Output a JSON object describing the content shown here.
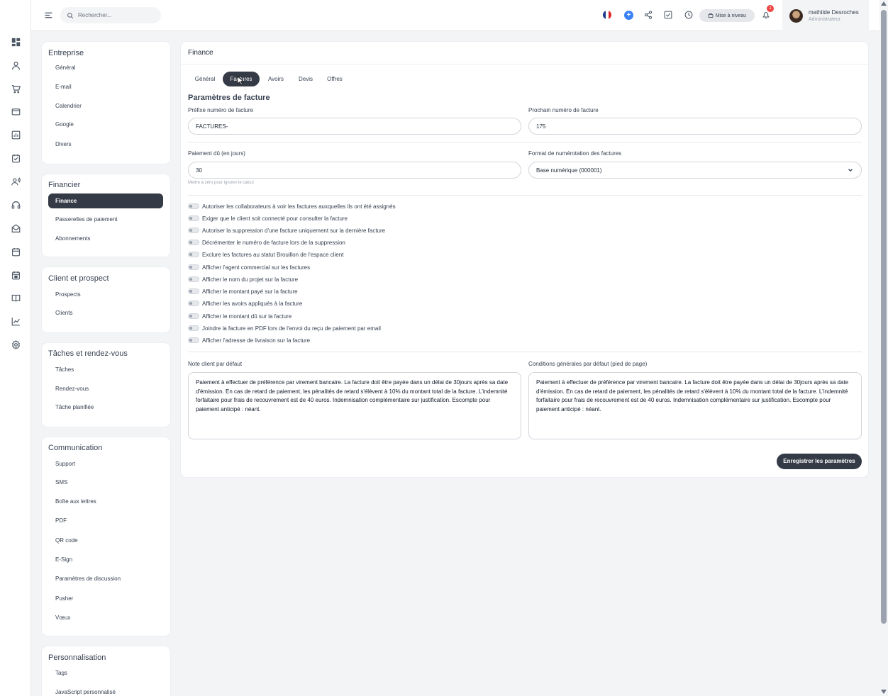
{
  "search": {
    "placeholder": "Rechercher..."
  },
  "topbar": {
    "upgrade_label": "Mise à niveau",
    "notifications_count": "1",
    "user_name": "mathilde Desroches",
    "user_role": "Administrateur"
  },
  "sidebar": {
    "groups": [
      {
        "title": "Entreprise",
        "items": [
          {
            "label": "Général"
          },
          {
            "label": "E-mail"
          },
          {
            "label": "Calendrier"
          },
          {
            "label": "Google"
          },
          {
            "label": "Divers"
          }
        ]
      },
      {
        "title": "Financier",
        "items": [
          {
            "label": "Finance",
            "active": true
          },
          {
            "label": "Passerelles de paiement"
          },
          {
            "label": "Abonnements"
          }
        ]
      },
      {
        "title": "Client et prospect",
        "items": [
          {
            "label": "Prospects"
          },
          {
            "label": "Clients"
          }
        ]
      },
      {
        "title": "Tâches et rendez-vous",
        "items": [
          {
            "label": "Tâches"
          },
          {
            "label": "Rendez-vous"
          },
          {
            "label": "Tâche planifiée"
          }
        ]
      },
      {
        "title": "Communication",
        "items": [
          {
            "label": "Support"
          },
          {
            "label": "SMS"
          },
          {
            "label": "Boîte aux lettres"
          },
          {
            "label": "PDF"
          },
          {
            "label": "QR code"
          },
          {
            "label": "E-Sign"
          },
          {
            "label": "Paramètres de discussion"
          },
          {
            "label": "Pusher"
          },
          {
            "label": "Vœux"
          }
        ]
      },
      {
        "title": "Personnalisation",
        "items": [
          {
            "label": "Tags"
          },
          {
            "label": "JavaScript personnalisé"
          }
        ]
      }
    ]
  },
  "main": {
    "title": "Finance",
    "tabs": [
      {
        "label": "Général"
      },
      {
        "label": "Factures",
        "active": true
      },
      {
        "label": "Avoirs"
      },
      {
        "label": "Devis"
      },
      {
        "label": "Offres"
      }
    ],
    "section_title": "Paramètres de facture",
    "fields": {
      "prefix_label": "Préfixe numéro de facture",
      "prefix_value": "FACTURES-",
      "next_number_label": "Prochain numéro de facture",
      "next_number_value": "175",
      "due_label": "Paiement dû (en jours)",
      "due_value": "30",
      "due_hint": "Mettre à zéro pour ignorer le calcul",
      "format_label": "Format de numérotation des factures",
      "format_value": "Base numérique (000001)"
    },
    "toggles": [
      {
        "label": "Autoriser les collaborateurs à voir les factures auxquelles ils ont été assignés",
        "on": false
      },
      {
        "label": "Exiger que le client soit connecté pour consulter la facture",
        "on": false
      },
      {
        "label": "Autoriser la suppression d'une facture uniquement sur la dernière facture",
        "on": false
      },
      {
        "label": "Décrémenter le numéro de facture lors de la suppression",
        "on": false
      },
      {
        "label": "Exclure les factures au statut Brouillon de l'espace client",
        "on": false
      },
      {
        "label": "Afficher l'agent commercial sur les factures",
        "on": false
      },
      {
        "label": "Afficher le nom du projet sur la facture",
        "on": false
      },
      {
        "label": "Afficher le montant payé sur la facture",
        "on": false
      },
      {
        "label": "Afficher les avoirs appliqués à la facture",
        "on": false
      },
      {
        "label": "Afficher le montant dû sur la facture",
        "on": false
      },
      {
        "label": "Joindre la facture en PDF lors de l'envoi du reçu de paiement par email",
        "on": false
      },
      {
        "label": "Afficher l'adresse de livraison sur la facture",
        "on": false
      }
    ],
    "client_note_label": "Note client par défaut",
    "client_note_value": "Paiement à effectuer de préférence par virement bancaire. La facture doit être payée dans un délai de 30jours après sa date d'émission. En cas de retard de paiement, les pénalités de retard s'élèvent à 10% du montant total de la facture. L'indemnité forfaitaire pour frais de recouvrement est de 40 euros. Indemnisation complémentaire sur justification. Escompte pour paiement anticipé : néant.",
    "terms_label": "Conditions générales par défaut (pied de page)",
    "terms_value": "Paiement à effectuer de préférence par virement bancaire. La facture doit être payée dans un délai de 30jours après sa date d'émission. En cas de retard de paiement, les pénalités de retard s'élèvent à 10% du montant total de la facture. L'indemnité forfaitaire pour frais de recouvrement est de 40 euros. Indemnisation complémentaire sur justification. Escompte pour paiement anticipé : néant.",
    "save_label": "Enregistrer les paramètres"
  },
  "icons": {
    "rail": [
      "dashboard-icon",
      "user-icon",
      "cart-icon",
      "wallet-icon",
      "report-icon",
      "task-icon",
      "contacts-icon",
      "headset-icon",
      "mail-icon",
      "calendar-icon",
      "event-icon",
      "book-icon",
      "chart-icon",
      "settings-icon"
    ]
  },
  "colors": {
    "accent": "#343a46",
    "plus": "#3b82f6",
    "badge": "#ef4444"
  }
}
